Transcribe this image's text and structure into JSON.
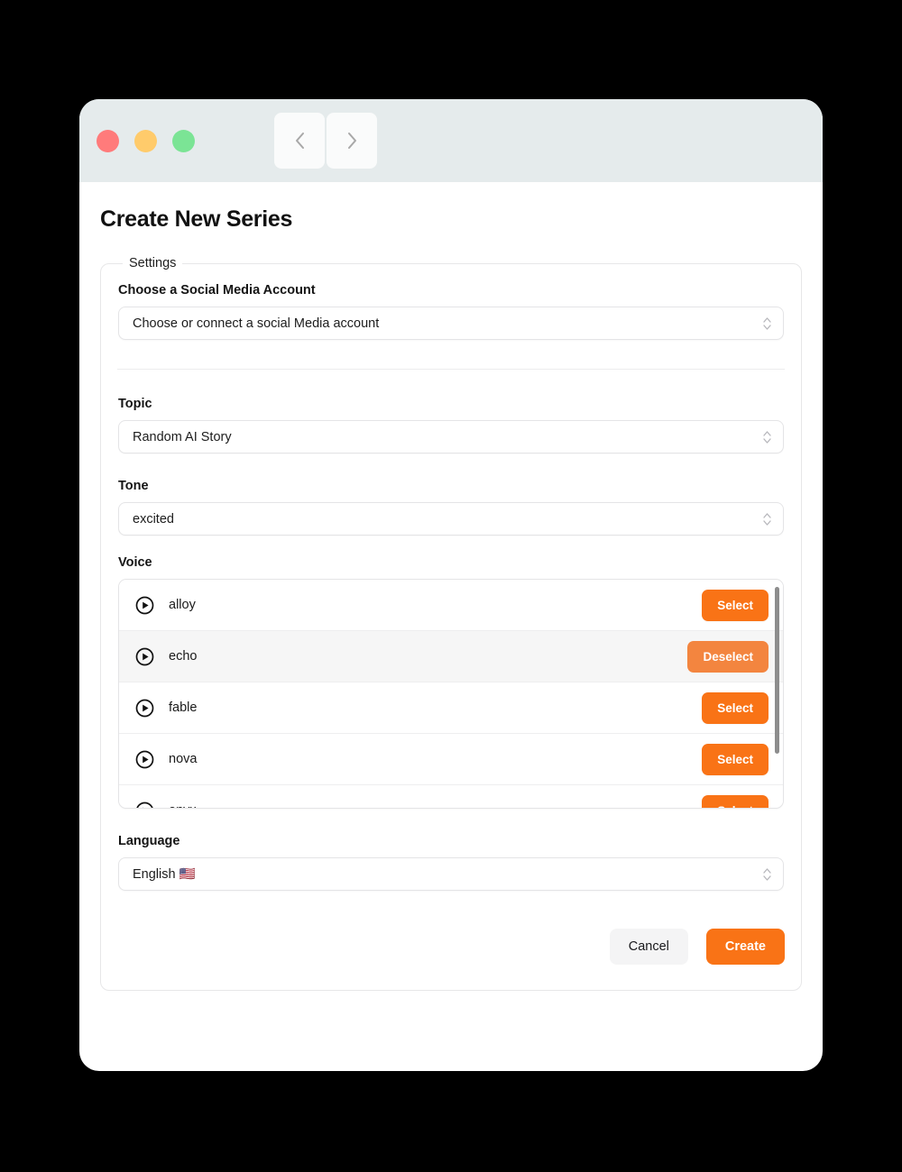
{
  "window": {
    "traffic_lights": [
      {
        "name": "close",
        "color": "#ff7b7b"
      },
      {
        "name": "minimize",
        "color": "#ffcb6b"
      },
      {
        "name": "maximize",
        "color": "#7be495"
      }
    ],
    "nav": {
      "back_icon": "chevron-left-icon",
      "forward_icon": "chevron-right-icon"
    }
  },
  "page": {
    "title": "Create New Series"
  },
  "settings": {
    "legend": "Settings",
    "account": {
      "label": "Choose a Social Media Account",
      "value": "Choose or connect a social Media account"
    },
    "topic": {
      "label": "Topic",
      "value": "Random AI Story"
    },
    "tone": {
      "label": "Tone",
      "value": "excited"
    },
    "voice": {
      "label": "Voice",
      "select_label": "Select",
      "deselect_label": "Deselect",
      "items": [
        {
          "name": "alloy",
          "selected": false
        },
        {
          "name": "echo",
          "selected": true
        },
        {
          "name": "fable",
          "selected": false
        },
        {
          "name": "nova",
          "selected": false
        },
        {
          "name": "onyx",
          "selected": false
        }
      ]
    },
    "language": {
      "label": "Language",
      "value": "English 🇺🇸"
    }
  },
  "footer": {
    "cancel_label": "Cancel",
    "create_label": "Create"
  },
  "colors": {
    "accent": "#f97316",
    "accent_muted": "#f3853f",
    "titlebar": "#e5ebec",
    "page_background": "#000000"
  }
}
